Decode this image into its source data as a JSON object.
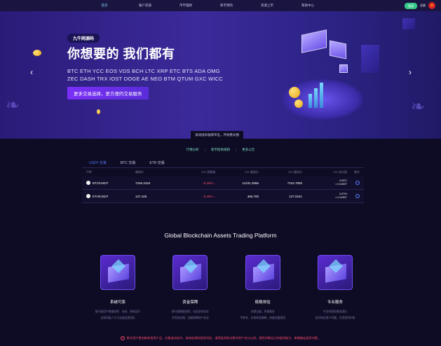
{
  "nav": {
    "items": [
      "首页",
      "账户充值",
      "币币理财",
      "新币预热",
      "资源上币",
      "帮助中心"
    ],
    "login": "登录",
    "register": "注册"
  },
  "hero": {
    "badge": "九牛网源码",
    "title": "你想要的  我们都有",
    "coins": "BTC ETH YCC EOS VDS BCH LTC XRP ETC BTS ADA OMG ZEC DASH TRX IOST DOGE AE NEO BTM QTUM GXC WICC ...",
    "cta": "更多交易选择，更方便的交易服务",
    "hint": "滚动鼠标轴或单击，开始看长图"
  },
  "announce": {
    "items": [
      "行情分析",
      "新币招商规则",
      "更多公告"
    ]
  },
  "market": {
    "tabs": [
      "USDT 交易",
      "BTC 交易",
      "ETH 交易"
    ],
    "headers": [
      "币种",
      "最新价",
      "24h 涨跌幅",
      "24h 最高价",
      "24h 最低价",
      "24h 成交量",
      "操作"
    ],
    "rows": [
      {
        "pair": "BTC/USDT",
        "price": "7246.3152",
        "change": "-0.18%",
        "high": "11231.2066",
        "low": "7222.7093",
        "vol1": "0 BTC",
        "vol2": "≈ 0 USDT"
      },
      {
        "pair": "ETH/USDT",
        "price": "127.426",
        "change": "-0.18%",
        "high": "466.700",
        "low": "127.0241",
        "vol1": "0 ETH",
        "vol2": "≈ 0 USDT"
      }
    ]
  },
  "section_title": "Global Blockchain Assets Trading Platform",
  "features": [
    {
      "title": "系统可靠",
      "desc1": "银行级用户数据加密、动态、高效运行",
      "desc2": "全球顶级人才与全速运营团队"
    },
    {
      "title": "资金保障",
      "desc1": "银行级数据加密，动态身份验证",
      "desc2": "冷钱包存储，全额保障资产安全"
    },
    {
      "title": "极致体验",
      "desc1": "充提迅速，多重服务",
      "desc2": "币种多、交易体验顺畅，快速充值提现"
    },
    {
      "title": "专业服务",
      "desc1": "专业的国际服务团队",
      "desc2": "实时响应用户问题，为您保驾护航"
    }
  ],
  "risk_notice": "数字资产是创新的投资产品，价格波动较大，具有较高的投资风险，请您投资前对数字资产充分认知，理性判断自己的投资能力，审慎做出投资决策。"
}
